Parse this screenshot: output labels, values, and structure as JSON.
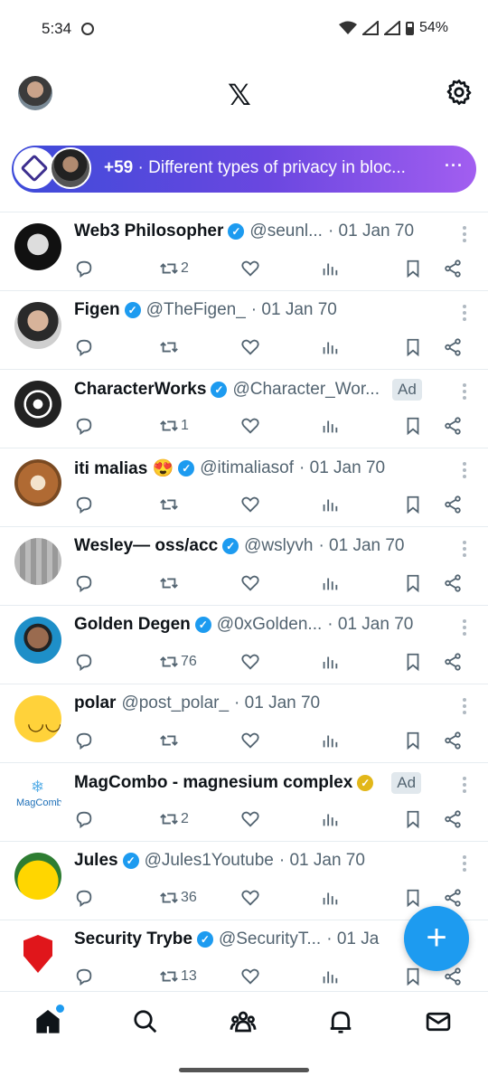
{
  "status_bar": {
    "time": "5:34",
    "battery": "54%"
  },
  "header": {
    "logo": "𝕏"
  },
  "spaces_banner": {
    "count": "+59",
    "title": "· Different types of privacy in bloc...",
    "more": "···"
  },
  "tweets": [
    {
      "name": "Web3 Philosopher",
      "verified": "blue",
      "handle": "@seunl...",
      "date": "· 01 Jan 70",
      "ad": "",
      "retweets": "2"
    },
    {
      "name": "Figen",
      "verified": "blue",
      "handle": "@TheFigen_",
      "date": "· 01 Jan 70",
      "ad": "",
      "retweets": ""
    },
    {
      "name": "CharacterWorks",
      "verified": "blue",
      "handle": "@Character_Wor...",
      "date": "",
      "ad": "Ad",
      "retweets": "1"
    },
    {
      "name": "iti malias 😍",
      "verified": "blue",
      "handle": "@itimaliasof",
      "date": "· 01 Jan 70",
      "ad": "",
      "retweets": ""
    },
    {
      "name": "Wesley— oss/acc",
      "verified": "blue",
      "handle": "@wslyvh",
      "date": "· 01 Jan 70",
      "ad": "",
      "retweets": ""
    },
    {
      "name": "Golden Degen",
      "verified": "blue",
      "handle": "@0xGolden...",
      "date": "· 01 Jan 70",
      "ad": "",
      "retweets": "76"
    },
    {
      "name": "polar",
      "verified": "",
      "handle": "@post_polar_",
      "date": "· 01 Jan 70",
      "ad": "",
      "retweets": ""
    },
    {
      "name": "MagCombo - magnesium complex",
      "verified": "gold",
      "handle": "",
      "date": "",
      "ad": "Ad",
      "retweets": "2"
    },
    {
      "name": "Jules",
      "verified": "blue",
      "handle": "@Jules1Youtube",
      "date": "· 01 Jan 70",
      "ad": "",
      "retweets": "36"
    },
    {
      "name": "Security Trybe",
      "verified": "blue",
      "handle": "@SecurityT...",
      "date": "· 01 Ja",
      "ad": "",
      "retweets": "13"
    }
  ],
  "magcombo_logo": "MagCombo",
  "fab": {
    "label": "+"
  },
  "colors": {
    "accent": "#1d9bf0",
    "banner_start": "#3d4bd9",
    "banner_end": "#a25ef0"
  }
}
